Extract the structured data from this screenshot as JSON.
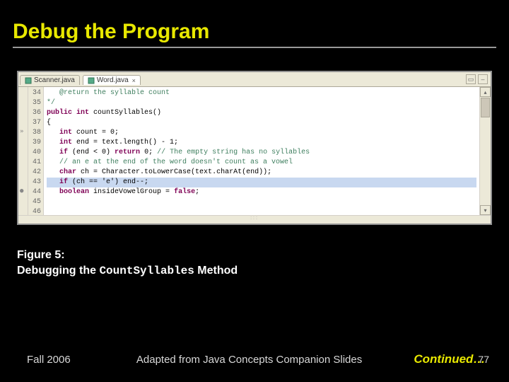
{
  "title": "Debug the Program",
  "ide": {
    "tabs": [
      {
        "label": "Scanner.java",
        "active": false
      },
      {
        "label": "Word.java",
        "active": true
      }
    ],
    "line_numbers": [
      "34",
      "35",
      "36",
      "37",
      "38",
      "39",
      "40",
      "41",
      "42",
      "43",
      "44",
      "45",
      "46"
    ],
    "gutter_marks": {
      "38": "»",
      "44": "●"
    },
    "code_lines": [
      {
        "cls": "c-comment",
        "text": "   @return the syllable count"
      },
      {
        "cls": "c-comment",
        "text": "*/"
      },
      {
        "cls": "",
        "html": "<span class=\"c-keyword\">public int</span> countSyllables()"
      },
      {
        "cls": "",
        "text": "{"
      },
      {
        "cls": "",
        "html": "   <span class=\"c-keyword\">int</span> count = 0;"
      },
      {
        "cls": "",
        "html": "   <span class=\"c-keyword\">int</span> end = text.length() - 1;"
      },
      {
        "cls": "",
        "html": "   <span class=\"c-keyword\">if</span> (end &lt; 0) <span class=\"c-keyword\">return</span> 0; <span class=\"c-comment\">// The empty string has no syllables</span>"
      },
      {
        "cls": "",
        "text": ""
      },
      {
        "cls": "c-comment",
        "text": "   // an e at the end of the word doesn't count as a vowel"
      },
      {
        "cls": "",
        "html": "   <span class=\"c-keyword\">char</span> ch = Character.toLowerCase(text.charAt(end));"
      },
      {
        "cls": "c-hl",
        "html": "   <span class=\"c-keyword\">if</span> (ch == 'e') end--;"
      },
      {
        "cls": "",
        "text": ""
      },
      {
        "cls": "",
        "html": "   <span class=\"c-keyword\">boolean</span> insideVowelGroup = <span class=\"c-keyword\">false</span>;"
      }
    ]
  },
  "caption": {
    "line1": "Figure 5:",
    "line2a": "Debugging the ",
    "line2b": "CountSyllables",
    "line2c": " Method"
  },
  "footer": {
    "left": "Fall 2006",
    "center": "Adapted from Java Concepts Companion Slides",
    "right": "Continued…",
    "page": "77"
  }
}
